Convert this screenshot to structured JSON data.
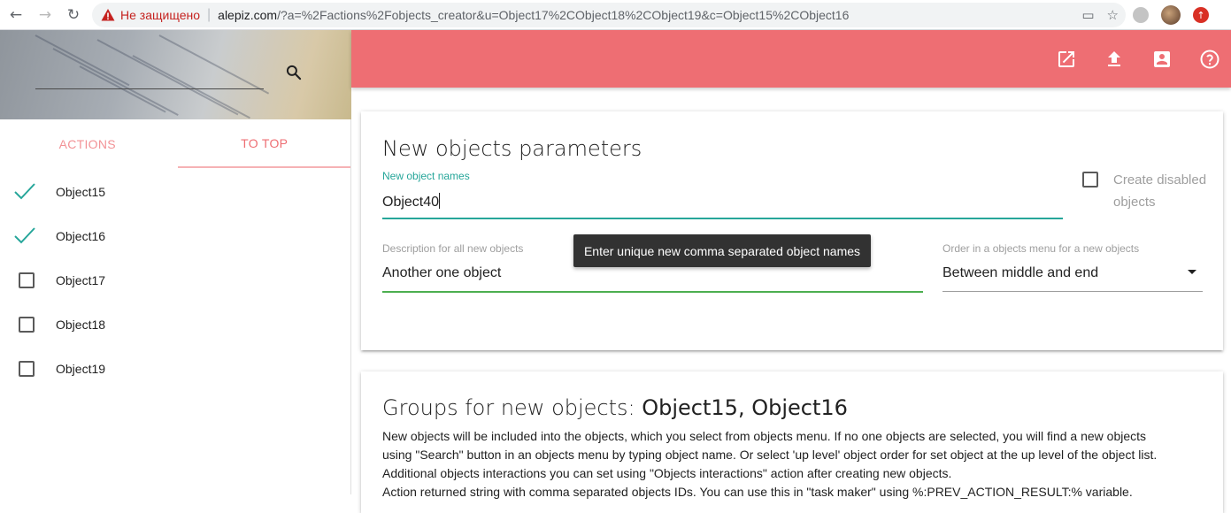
{
  "browser": {
    "insecure_label": "Не защищено",
    "url_host": "alepiz.com",
    "url_rest": "/?a=%2Factions%2Fobjects_creator&u=Object17%2CObject18%2CObject19&c=Object15%2CObject16"
  },
  "sidebar": {
    "tabs": [
      {
        "label": "ACTIONS"
      },
      {
        "label": "TO TOP"
      }
    ],
    "objects": [
      {
        "label": "Object15",
        "checked": true
      },
      {
        "label": "Object16",
        "checked": true
      },
      {
        "label": "Object17",
        "checked": false
      },
      {
        "label": "Object18",
        "checked": false
      },
      {
        "label": "Object19",
        "checked": false
      }
    ]
  },
  "colors": {
    "accent": "#ee6e73",
    "check": "#26a69a",
    "field_active": "#26a69a",
    "field_valid": "#4caf50"
  },
  "toolbar_icons": [
    "open-in-new-icon",
    "upload-icon",
    "account-box-icon",
    "help-icon"
  ],
  "parameters": {
    "title": "New objects parameters",
    "names_label": "New object names",
    "names_value": "Object40",
    "create_disabled_label": "Create disabled objects",
    "description_label": "Description for all new objects",
    "description_value": "Another one object",
    "order_label": "Order in a objects menu for a new objects",
    "order_value": "Between middle and end",
    "tooltip": "Enter unique new comma separated object names"
  },
  "groups": {
    "title_prefix": "Groups for new objects: ",
    "title_objects": "Object15, Object16",
    "lines": [
      "New objects will be included into the objects, which you select from objects menu. If no one objects are selected, you will find a new objects",
      "using \"Search\" button in an objects menu by typing object name. Or select 'up level' object order for set object at the up level of the object list.",
      "Additional objects interactions you can set using \"Objects interactions\" action after creating new objects.",
      "Action returned string with comma separated objects IDs. You can use this in \"task maker\" using %:PREV_ACTION_RESULT:% variable."
    ]
  }
}
